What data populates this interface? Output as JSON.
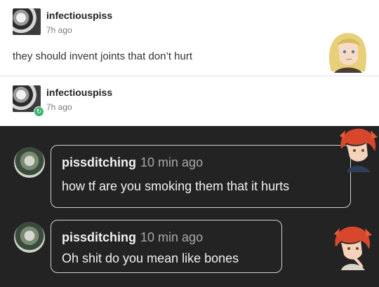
{
  "posts": [
    {
      "username": "infectiouspiss",
      "time_ago": "7h ago",
      "text": "they should invent joints that don’t hurt",
      "avatar_icon": "bw-avatar"
    },
    {
      "username": "infectiouspiss",
      "time_ago": "7h ago",
      "avatar_icon": "bw-avatar",
      "badge_icon": "reblog-icon"
    }
  ],
  "comments": [
    {
      "username": "pissditching",
      "time_ago": "10 min ago",
      "text": "how tf are you smoking them that it hurts"
    },
    {
      "username": "pissditching",
      "time_ago": "10 min ago",
      "text": "Oh shit do you mean like bones"
    }
  ],
  "colors": {
    "dark_bg": "#232323",
    "bubble_border": "#d0d0d0",
    "badge": "#3bb272"
  }
}
